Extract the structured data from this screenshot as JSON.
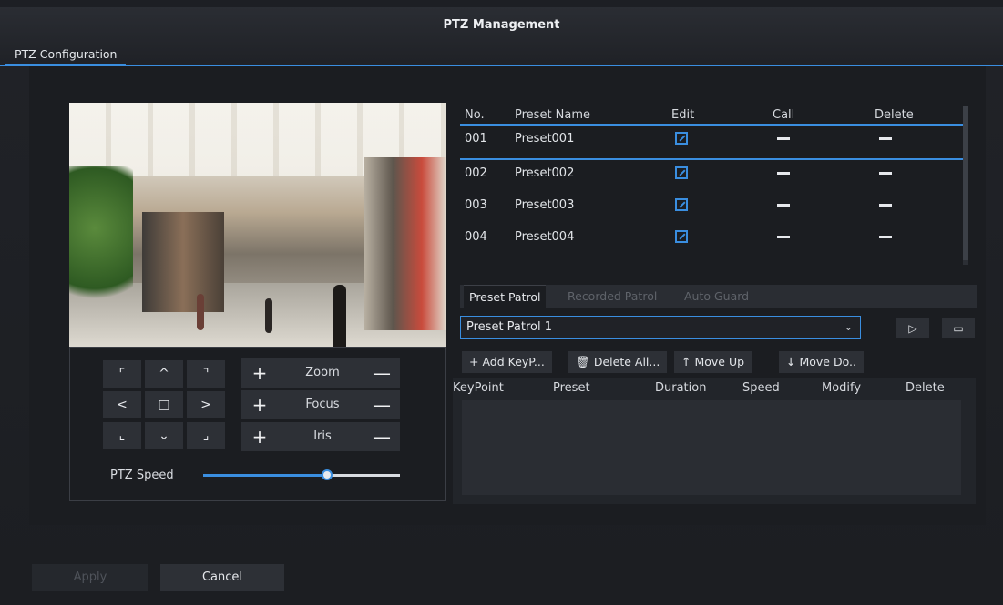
{
  "window": {
    "title": "PTZ Management"
  },
  "tabs": [
    {
      "label": "PTZ Configuration",
      "active": true
    }
  ],
  "ptz_controls": {
    "directions": {
      "up_left": "⌜",
      "up": "^",
      "up_right": "⌝",
      "left": "<",
      "home": "□",
      "right": ">",
      "down_left": "⌞",
      "down": "⌄",
      "down_right": "⌟"
    },
    "zoom_label": "Zoom",
    "focus_label": "Focus",
    "iris_label": "Iris",
    "plus": "+",
    "minus": "—",
    "speed_label": "PTZ Speed",
    "speed_fraction": 0.63
  },
  "preset_table": {
    "headers": {
      "no": "No.",
      "name": "Preset Name",
      "edit": "Edit",
      "call": "Call",
      "delete": "Delete"
    },
    "rows": [
      {
        "no": "001",
        "name": "Preset001"
      },
      {
        "no": "002",
        "name": "Preset002"
      },
      {
        "no": "003",
        "name": "Preset003"
      },
      {
        "no": "004",
        "name": "Preset004"
      }
    ]
  },
  "patrol_tabs": [
    {
      "label": "Preset Patrol",
      "active": true
    },
    {
      "label": "Recorded Patrol",
      "active": false
    },
    {
      "label": "Auto Guard",
      "active": false
    }
  ],
  "patrol_select": {
    "value": "Preset Patrol 1"
  },
  "patrol_buttons": {
    "play": "▷",
    "stop": "▭"
  },
  "patrol_toolbar": {
    "add": "+  Add KeyP...",
    "delete_all": "Delete All...",
    "move_up": "Move Up",
    "move_down": "Move Do.."
  },
  "keypoint_table": {
    "headers": {
      "keypoint": "KeyPoint",
      "preset": "Preset",
      "duration": "Duration",
      "speed": "Speed",
      "modify": "Modify",
      "delete": "Delete"
    }
  },
  "footer": {
    "apply": "Apply",
    "cancel": "Cancel"
  },
  "colors": {
    "accent": "#3a8ee0",
    "background": "#1d1f24",
    "button": "#2d3036"
  }
}
